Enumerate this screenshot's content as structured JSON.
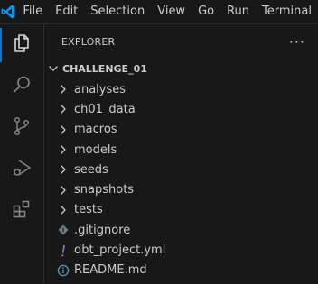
{
  "menubar": {
    "items": [
      "File",
      "Edit",
      "Selection",
      "View",
      "Go",
      "Run",
      "Terminal"
    ]
  },
  "activity": {
    "items": [
      {
        "name": "explorer",
        "icon": "files-icon",
        "active": true
      },
      {
        "name": "search",
        "icon": "search-icon",
        "active": false
      },
      {
        "name": "source-control",
        "icon": "source-control-icon",
        "active": false
      },
      {
        "name": "run-debug",
        "icon": "run-debug-icon",
        "active": false
      },
      {
        "name": "extensions",
        "icon": "extensions-icon",
        "active": false
      }
    ]
  },
  "explorer": {
    "title": "EXPLORER",
    "more_label": "···",
    "root": "CHALLENGE_01",
    "folders": [
      "analyses",
      "ch01_data",
      "macros",
      "models",
      "seeds",
      "snapshots",
      "tests"
    ],
    "files": [
      {
        "name": ".gitignore",
        "icon": "gitignore-icon",
        "color": "#6d8086"
      },
      {
        "name": "dbt_project.yml",
        "icon": "yaml-icon",
        "color": "#a074c4"
      },
      {
        "name": "README.md",
        "icon": "info-icon",
        "color": "#519aba"
      }
    ]
  },
  "colors": {
    "accent": "#0078d4",
    "logo": "#0098ff",
    "background": "#181818",
    "text": "#cccccc"
  }
}
